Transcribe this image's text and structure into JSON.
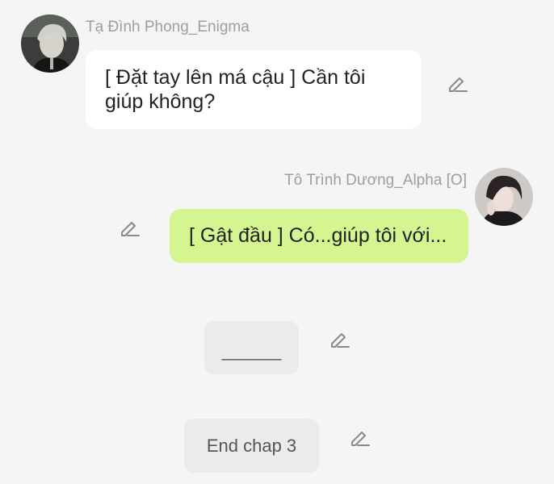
{
  "messages": [
    {
      "sender": "Tạ Đình Phong_Enigma",
      "text": "[ Đặt tay lên má cậu ] Cần tôi giúp không?",
      "avatar_icon": "avatar-silver-hair"
    },
    {
      "sender": "Tô Trình Dương_Alpha [O]",
      "text": "[ Gật đầu ] Có...giúp tôi với...",
      "avatar_icon": "avatar-dark-hair"
    }
  ],
  "narrations": [
    {
      "text": "______"
    },
    {
      "text": "End chap 3"
    }
  ],
  "icons": {
    "edit": "pencil-edit-icon"
  },
  "colors": {
    "background": "#f5f5f5",
    "left_bubble": "#ffffff",
    "right_bubble": "#d4f58f",
    "narration_bubble": "#ebebeb",
    "sender_name": "#9e9e9e"
  }
}
